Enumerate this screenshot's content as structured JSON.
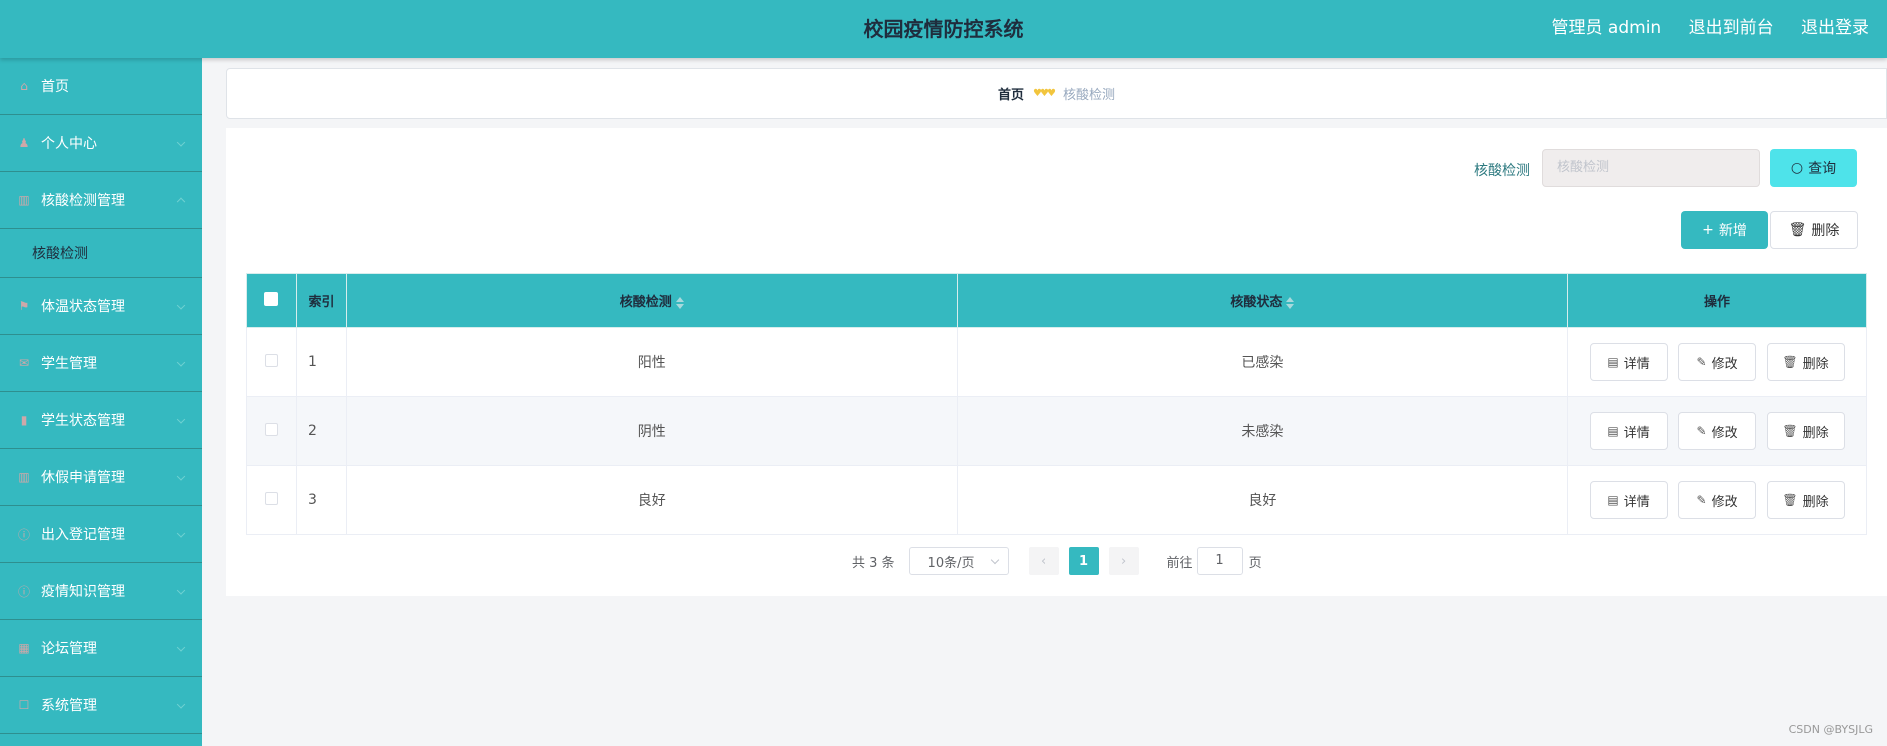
{
  "header": {
    "title": "校园疫情防控系统",
    "user": "管理员 admin",
    "to_front": "退出到前台",
    "logout": "退出登录"
  },
  "sidebar": {
    "items": [
      {
        "label": "首页",
        "icon": "home-icon"
      },
      {
        "label": "个人中心",
        "icon": "user-icon"
      },
      {
        "label": "核酸检测管理",
        "icon": "chart-icon"
      },
      {
        "label": "体温状态管理",
        "icon": "flag-icon"
      },
      {
        "label": "学生管理",
        "icon": "mail-icon"
      },
      {
        "label": "学生状态管理",
        "icon": "bar-chart-icon"
      },
      {
        "label": "休假申请管理",
        "icon": "chart-icon"
      },
      {
        "label": "出入登记管理",
        "icon": "info-icon"
      },
      {
        "label": "疫情知识管理",
        "icon": "info-icon"
      },
      {
        "label": "论坛管理",
        "icon": "grid-icon"
      },
      {
        "label": "系统管理",
        "icon": "square-icon"
      }
    ],
    "submenu_label": "核酸检测"
  },
  "breadcrumb": {
    "home": "首页",
    "separator": "♥♥♥",
    "current": "核酸检测"
  },
  "search": {
    "label": "核酸检测",
    "placeholder": "核酸检测",
    "query_button": "查询"
  },
  "actions": {
    "add_button": "新增",
    "delete_button": "删除"
  },
  "table": {
    "headers": {
      "index": "索引",
      "test": "核酸检测",
      "status": "核酸状态",
      "ops": "操作"
    },
    "rows": [
      {
        "index": "1",
        "test": "阳性",
        "status": "已感染"
      },
      {
        "index": "2",
        "test": "阴性",
        "status": "未感染"
      },
      {
        "index": "3",
        "test": "良好",
        "status": "良好"
      }
    ],
    "row_buttons": {
      "detail": "详情",
      "edit": "修改",
      "delete": "删除"
    }
  },
  "pagination": {
    "total": "共 3 条",
    "page_size": "10条/页",
    "current_page": "1",
    "goto_prefix": "前往",
    "goto_value": "1",
    "goto_suffix": "页"
  },
  "watermark": "CSDN @BYSJLG",
  "colors": {
    "primary": "#35b9c0",
    "query_button": "#4ee3ea"
  }
}
